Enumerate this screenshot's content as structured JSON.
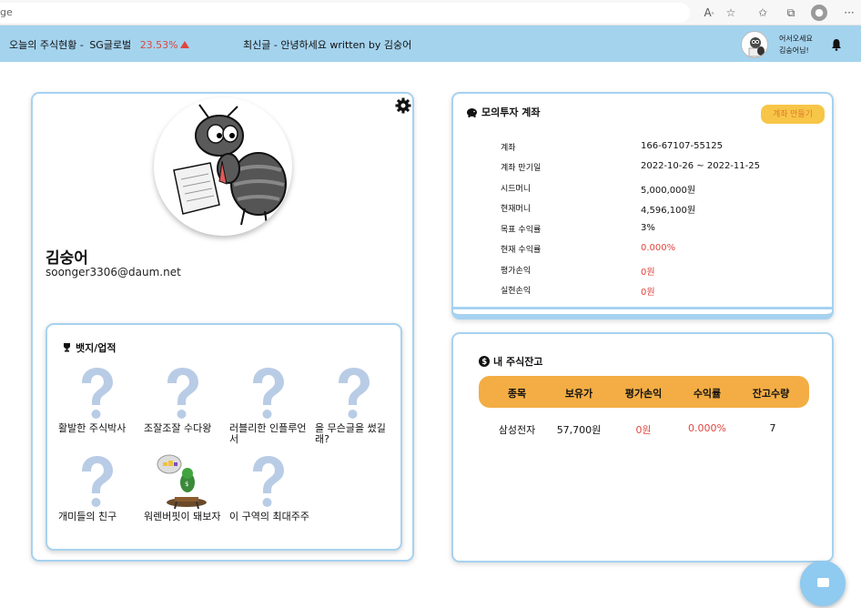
{
  "browser": {
    "url_text": "ge",
    "icons": [
      "read-aloud-icon",
      "favorite-add-icon",
      "favorites-icon",
      "collections-icon",
      "profile-icon",
      "more-icon"
    ]
  },
  "topbar": {
    "ticker_label": "오늘의 주식현황 -",
    "ticker_stock": "SG글로벌",
    "ticker_change": "23.53%",
    "news": "최신글 - 안녕하세요 written by 김숭어",
    "welcome_line1": "어서오세요",
    "welcome_line2": "김숭어님!"
  },
  "profile": {
    "name": "김숭어",
    "email": "soonger3306@daum.net"
  },
  "badges": {
    "title": "뱃지/업적",
    "items": [
      {
        "label": "활발한 주식박사",
        "icon": "question-mark-icon"
      },
      {
        "label": "조잘조잘 수다왕",
        "icon": "question-mark-icon"
      },
      {
        "label": "러블리한 인플루언서",
        "icon": "question-mark-icon"
      },
      {
        "label": "을 무슨글을 썼길래?",
        "icon": "question-mark-icon"
      },
      {
        "label": "개미들의 친구",
        "icon": "question-mark-icon"
      },
      {
        "label": "워렌버핏이 돼보자",
        "icon": "ant-investor-icon"
      },
      {
        "label": "이 구역의 최대주주",
        "icon": "question-mark-icon"
      }
    ]
  },
  "account": {
    "title": "모의투자 계좌",
    "make_button": "계좌 만들기",
    "rows": [
      {
        "key": "계좌",
        "value": "166-67107-55125",
        "red": false
      },
      {
        "key": "계좌 만기일",
        "value": "2022-10-26 ~ 2022-11-25",
        "red": false
      },
      {
        "key": "시드머니",
        "value": "5,000,000원",
        "red": false
      },
      {
        "key": "현재머니",
        "value": "4,596,100원",
        "red": false
      },
      {
        "key": "목표 수익률",
        "value": "3%",
        "red": false
      },
      {
        "key": "현재 수익률",
        "value": "0.000%",
        "red": true
      },
      {
        "key": "평가손익",
        "value": "0원",
        "red": true
      },
      {
        "key": "실현손익",
        "value": "0원",
        "red": true
      }
    ]
  },
  "holdings": {
    "title": "내 주식잔고",
    "headers": [
      "종목",
      "보유가",
      "평가손익",
      "수익률",
      "잔고수량"
    ],
    "rows": [
      [
        "삼성전자",
        "57,700원",
        "0원",
        "0.000%",
        "7"
      ]
    ]
  },
  "colors": {
    "topbar": "#a4d3ee",
    "card_border": "#a6d2f0",
    "accent_red": "#e0463f",
    "button_yellow": "#f7c648",
    "table_header": "#f3ad44"
  }
}
